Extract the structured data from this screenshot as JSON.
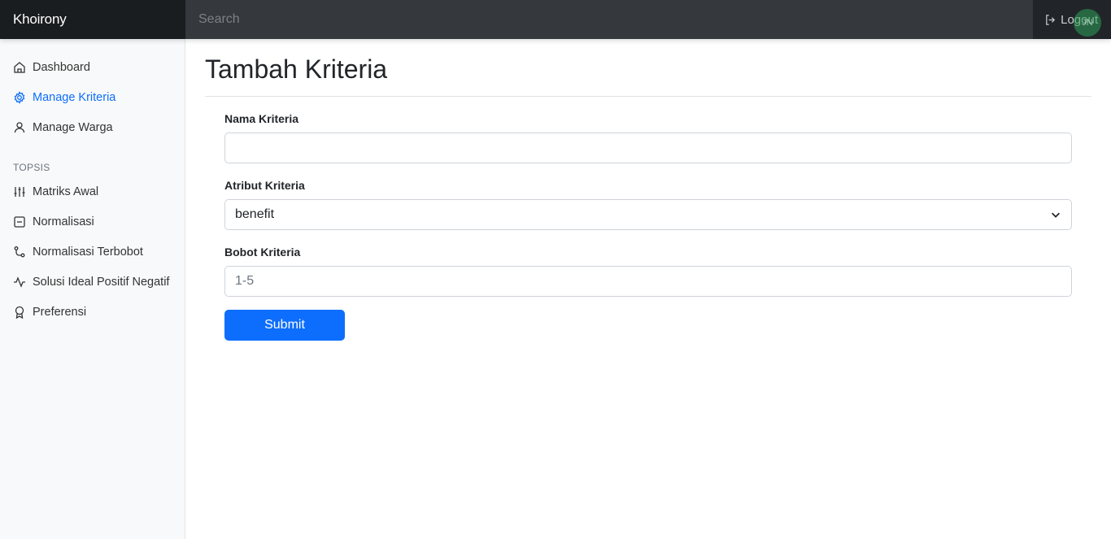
{
  "header": {
    "brand": "Khoirony",
    "search_placeholder": "Search",
    "logout_label": "Logout",
    "avatar_text": "JN"
  },
  "sidebar": {
    "items": [
      {
        "label": "Dashboard",
        "icon": "home-icon",
        "active": false
      },
      {
        "label": "Manage Kriteria",
        "icon": "gear-icon",
        "active": true
      },
      {
        "label": "Manage Warga",
        "icon": "user-icon",
        "active": false
      }
    ],
    "section_title": "TOPSIS",
    "topsis_items": [
      {
        "label": "Matriks Awal",
        "icon": "sliders-icon"
      },
      {
        "label": "Normalisasi",
        "icon": "minus-square-icon"
      },
      {
        "label": "Normalisasi Terbobot",
        "icon": "git-commit-icon"
      },
      {
        "label": "Solusi Ideal Positif Negatif",
        "icon": "activity-icon"
      },
      {
        "label": "Preferensi",
        "icon": "award-icon"
      }
    ]
  },
  "main": {
    "title": "Tambah Kriteria",
    "form": {
      "nama_label": "Nama Kriteria",
      "nama_value": "",
      "atribut_label": "Atribut Kriteria",
      "atribut_selected": "benefit",
      "bobot_label": "Bobot Kriteria",
      "bobot_placeholder": "1-5",
      "submit_label": "Submit"
    }
  },
  "colors": {
    "accent": "#0d6efd",
    "topbar": "#212529",
    "sidebar_bg": "#f8f9fa"
  }
}
